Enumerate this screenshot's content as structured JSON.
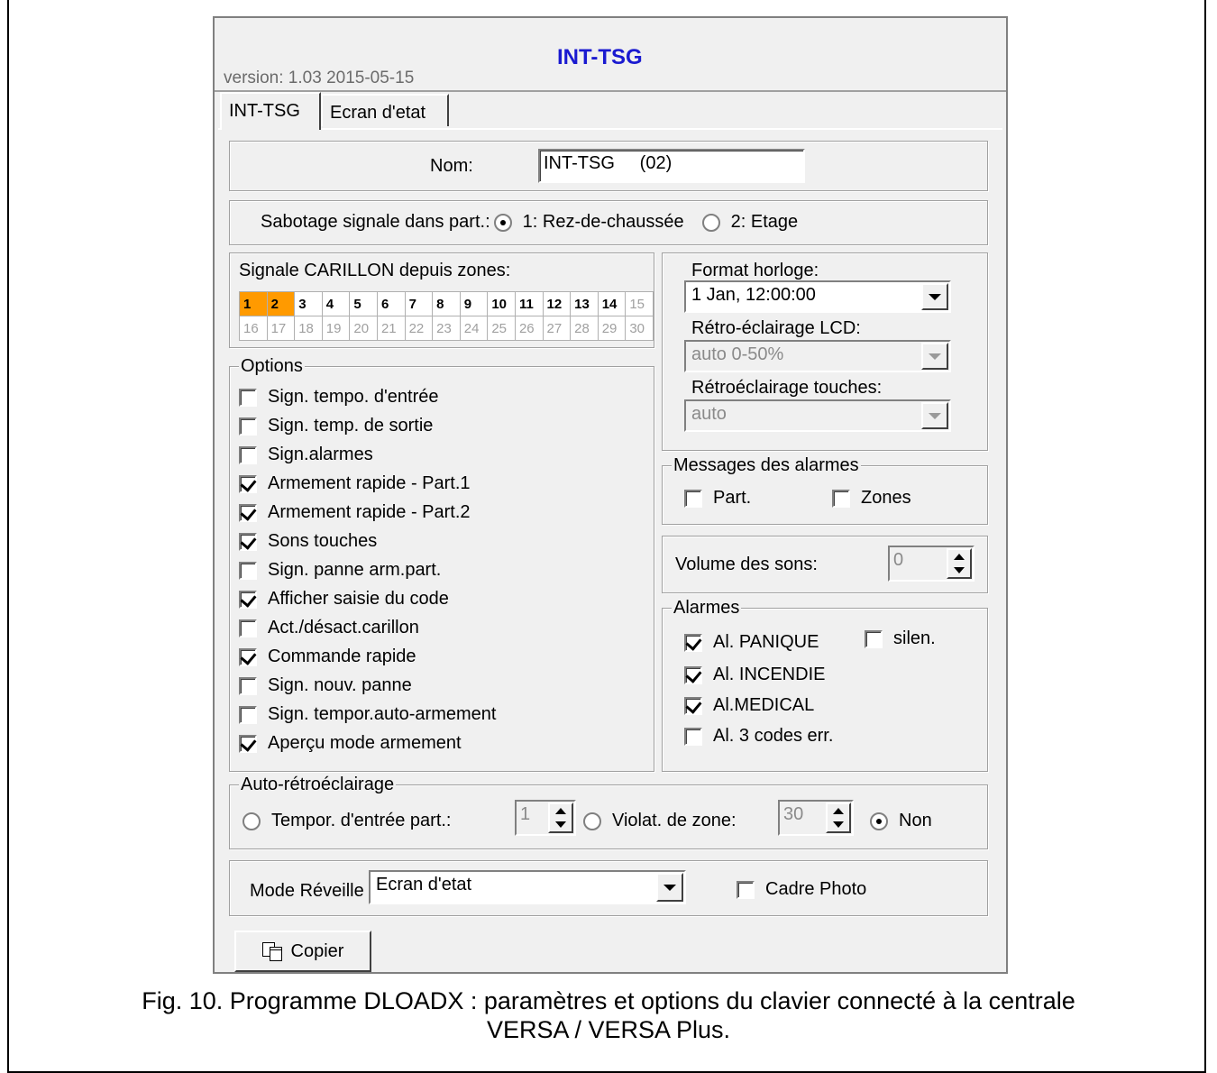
{
  "window": {
    "version": "version: 1.03 2015-05-15",
    "title": "INT-TSG"
  },
  "tabs": [
    {
      "label": "INT-TSG",
      "active": true
    },
    {
      "label": "Ecran d'etat",
      "active": false
    }
  ],
  "name": {
    "label": "Nom:",
    "value": "INT-TSG     (02)"
  },
  "tamper": {
    "label": "Sabotage signale dans part.:",
    "options": [
      {
        "label": "1: Rez-de-chaussée",
        "selected": true
      },
      {
        "label": "2: Etage",
        "selected": false
      }
    ]
  },
  "chime": {
    "label": "Signale CARILLON depuis zones:",
    "row1": [
      "1",
      "2",
      "3",
      "4",
      "5",
      "6",
      "7",
      "8",
      "9",
      "10",
      "11",
      "12",
      "13",
      "14",
      "15"
    ],
    "row2": [
      "16",
      "17",
      "18",
      "19",
      "20",
      "21",
      "22",
      "23",
      "24",
      "25",
      "26",
      "27",
      "28",
      "29",
      "30"
    ],
    "highlighted": [
      "1",
      "2"
    ]
  },
  "options": {
    "legend": "Options",
    "items": [
      {
        "label": "Sign. tempo. d'entrée",
        "checked": false
      },
      {
        "label": "Sign. temp. de sortie",
        "checked": false
      },
      {
        "label": "Sign.alarmes",
        "checked": false
      },
      {
        "label": "Armement rapide - Part.1",
        "checked": true
      },
      {
        "label": "Armement rapide - Part.2",
        "checked": true
      },
      {
        "label": "Sons touches",
        "checked": true
      },
      {
        "label": "Sign. panne arm.part.",
        "checked": false
      },
      {
        "label": "Afficher saisie du code",
        "checked": true
      },
      {
        "label": "Act./désact.carillon",
        "checked": false
      },
      {
        "label": "Commande rapide",
        "checked": true
      },
      {
        "label": "Sign. nouv. panne",
        "checked": false
      },
      {
        "label": "Sign. tempor.auto-armement",
        "checked": false
      },
      {
        "label": "Aperçu mode armement",
        "checked": true
      }
    ]
  },
  "clock": {
    "format_label": "Format horloge:",
    "format_value": "1 Jan, 12:00:00",
    "lcd_label": "Rétro-éclairage LCD:",
    "lcd_value": "auto 0-50%",
    "keys_label": "Rétroéclairage touches:",
    "keys_value": "auto"
  },
  "alarm_messages": {
    "legend": "Messages des alarmes",
    "part_label": "Part.",
    "part_checked": false,
    "zones_label": "Zones",
    "zones_checked": false
  },
  "volume": {
    "label": "Volume des sons:",
    "value": "0"
  },
  "alarms": {
    "legend": "Alarmes",
    "panic_label": "Al. PANIQUE",
    "panic_checked": true,
    "silent_label": "silen.",
    "silent_checked": false,
    "fire_label": "Al. INCENDIE",
    "fire_checked": true,
    "medical_label": "Al.MEDICAL",
    "medical_checked": true,
    "codes_label": "Al. 3 codes err.",
    "codes_checked": false
  },
  "auto_backlight": {
    "legend": "Auto-rétroéclairage",
    "entry_label": "Tempor. d'entrée part.:",
    "entry_value": "1",
    "zone_label": "Violat. de zone:",
    "zone_value": "30",
    "none_label": "Non",
    "selected": "none"
  },
  "wake": {
    "label": "Mode Réveille",
    "value": "Ecran d'etat",
    "photo_label": "Cadre Photo",
    "photo_checked": false
  },
  "copy_button": "Copier",
  "caption": {
    "line1": "Fig. 10. Programme DLOADX : paramètres et options du clavier connecté à la centrale",
    "line2": "VERSA / VERSA Plus."
  }
}
